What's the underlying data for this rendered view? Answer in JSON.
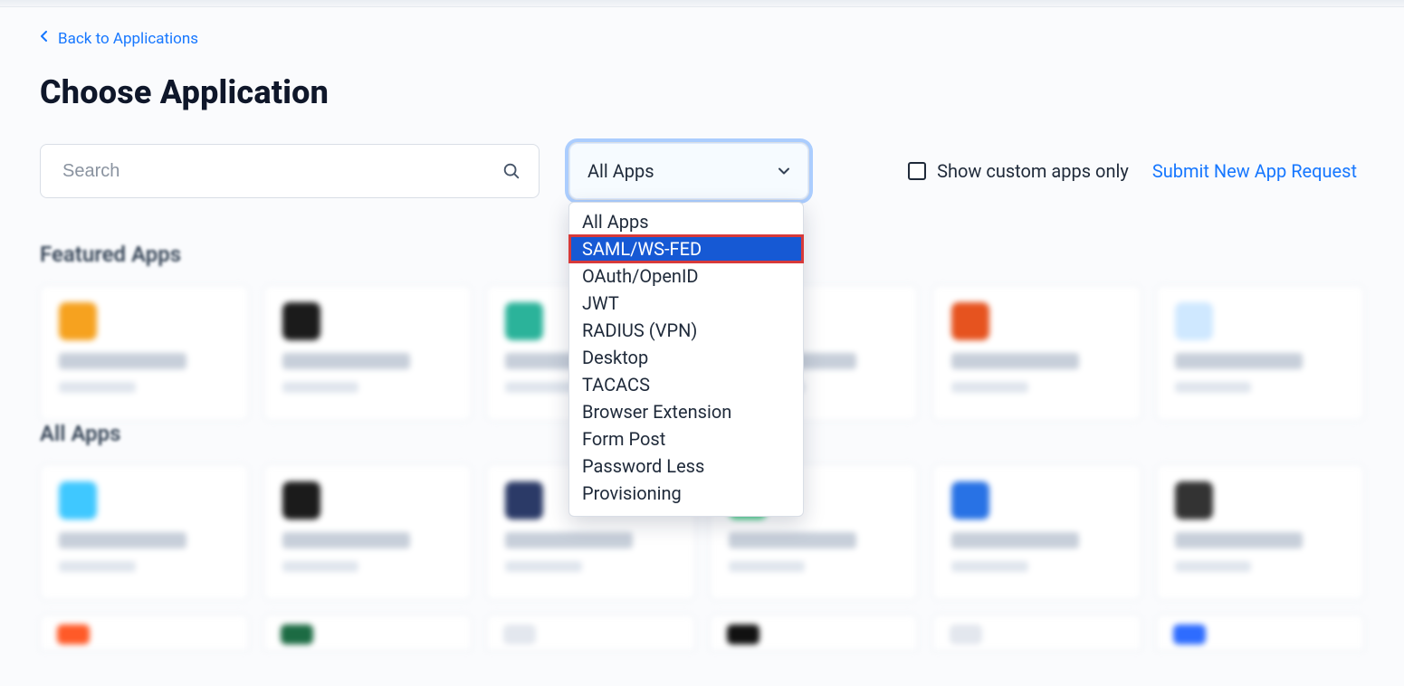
{
  "breadcrumb": {
    "back_label": "Back to Applications"
  },
  "page": {
    "title": "Choose Application"
  },
  "search": {
    "placeholder": "Search",
    "value": ""
  },
  "filter": {
    "selected_label": "All Apps",
    "options": [
      {
        "label": "All Apps",
        "selected": false
      },
      {
        "label": "SAML/WS-FED",
        "selected": true,
        "highlighted": true
      },
      {
        "label": "OAuth/OpenID",
        "selected": false
      },
      {
        "label": "JWT",
        "selected": false
      },
      {
        "label": "RADIUS (VPN)",
        "selected": false
      },
      {
        "label": "Desktop",
        "selected": false
      },
      {
        "label": "TACACS",
        "selected": false
      },
      {
        "label": "Browser Extension",
        "selected": false
      },
      {
        "label": "Form Post",
        "selected": false
      },
      {
        "label": "Password Less",
        "selected": false
      },
      {
        "label": "Provisioning",
        "selected": false
      }
    ]
  },
  "right": {
    "custom_only_label": "Show custom apps only",
    "submit_link": "Submit New App Request"
  },
  "sections": {
    "featured_title": "Featured Apps",
    "all_title": "All Apps"
  }
}
